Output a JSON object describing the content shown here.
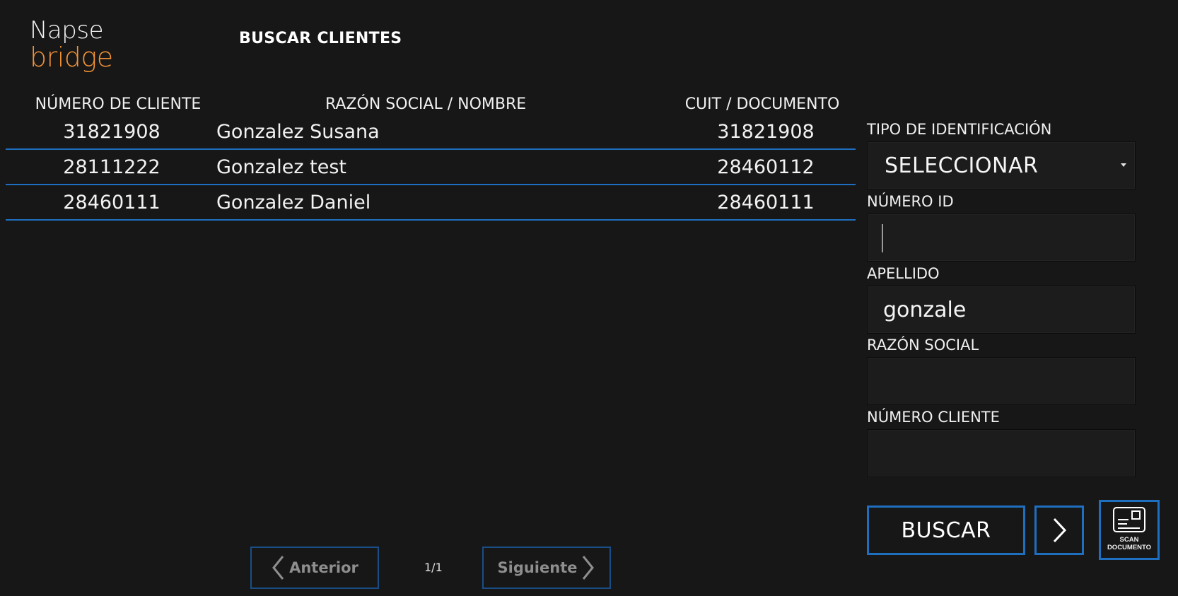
{
  "brand": {
    "line1": "Napse",
    "line2": "bridge",
    "color_primary": "#f2f2f2",
    "color_accent": "#f39237"
  },
  "page": {
    "title": "BUSCAR CLIENTES"
  },
  "table": {
    "headers": {
      "client_number": "NÚMERO DE CLIENTE",
      "name": "RAZÓN SOCIAL / NOMBRE",
      "document": "CUIT / DOCUMENTO"
    },
    "rows": [
      {
        "client_number": "31821908",
        "name": "Gonzalez Susana",
        "document": "31821908"
      },
      {
        "client_number": "28111222",
        "name": "Gonzalez test",
        "document": "28460112"
      },
      {
        "client_number": "28460111",
        "name": "Gonzalez Daniel",
        "document": "28460111"
      }
    ]
  },
  "form": {
    "id_type": {
      "label": "TIPO DE IDENTIFICACIÓN",
      "selected": "SELECCIONAR"
    },
    "id_number": {
      "label": "NÚMERO ID",
      "value": ""
    },
    "last_name": {
      "label": "APELLIDO",
      "value": "gonzale"
    },
    "business_name": {
      "label": "RAZÓN SOCIAL",
      "value": ""
    },
    "client_number": {
      "label": "NÚMERO CLIENTE",
      "value": ""
    }
  },
  "actions": {
    "search_label": "BUSCAR",
    "scan_label_line1": "SCAN",
    "scan_label_line2": "DOCUMENTO"
  },
  "pager": {
    "prev_label": "Anterior",
    "next_label": "Siguiente",
    "page_indicator": "1/1"
  },
  "colors": {
    "background": "#171717",
    "accent_blue": "#1e6fbf",
    "field_bg": "#1c1c1c"
  },
  "icons": {
    "next": "chevron-right-icon",
    "scan": "id-card-icon",
    "prev": "chevron-left-icon",
    "dropdown": "caret-down-icon"
  }
}
